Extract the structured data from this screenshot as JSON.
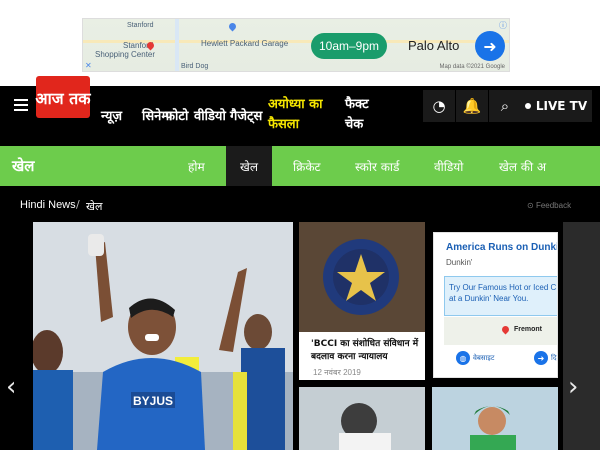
{
  "top_ad": {
    "map_labels": [
      "Stanford",
      "Shopping Center",
      "Hewlett Packard Garage",
      "Stanford",
      "Bird Dog"
    ],
    "hours": "10am–9pm",
    "city": "Palo Alto",
    "copyright": "Map data ©2021 Google"
  },
  "nav": {
    "logo_text": "आज तक",
    "items": [
      "न्यूज़",
      "सिनेमा",
      "फोटो",
      "वीडियो",
      "गैजेट्स"
    ],
    "highlight": "अयोध्या का फैसला",
    "fact_check": "फैक्ट चेक",
    "live_tv": "LIVE TV"
  },
  "section": {
    "title": "खेल",
    "tabs": [
      "होम",
      "खेल",
      "क्रिकेट",
      "स्कोर कार्ड",
      "वीडियो",
      "खेल की अ"
    ]
  },
  "breadcrumb": {
    "home": "Hindi News",
    "current": "खेल",
    "feedback": "Feedback"
  },
  "cards": [
    {
      "title": "'BCCI का संशोधित संविधान में बदलाव करना न्यायालय",
      "date": "12 नवंबर 2019"
    }
  ],
  "side_ad": {
    "title": "America Runs on Dunkin'",
    "subtitle": "Dunkin'",
    "message_l1": "Try Our Famous Hot or Iced C",
    "message_l2": "at a Dunkin' Near You.",
    "location": "Fremont",
    "btn1": "वेबसाइट",
    "btn2": "दि"
  },
  "colors": {
    "accent_red": "#e1261c",
    "section_green": "#6dcc4c",
    "highlight_yellow": "#f5e600"
  }
}
